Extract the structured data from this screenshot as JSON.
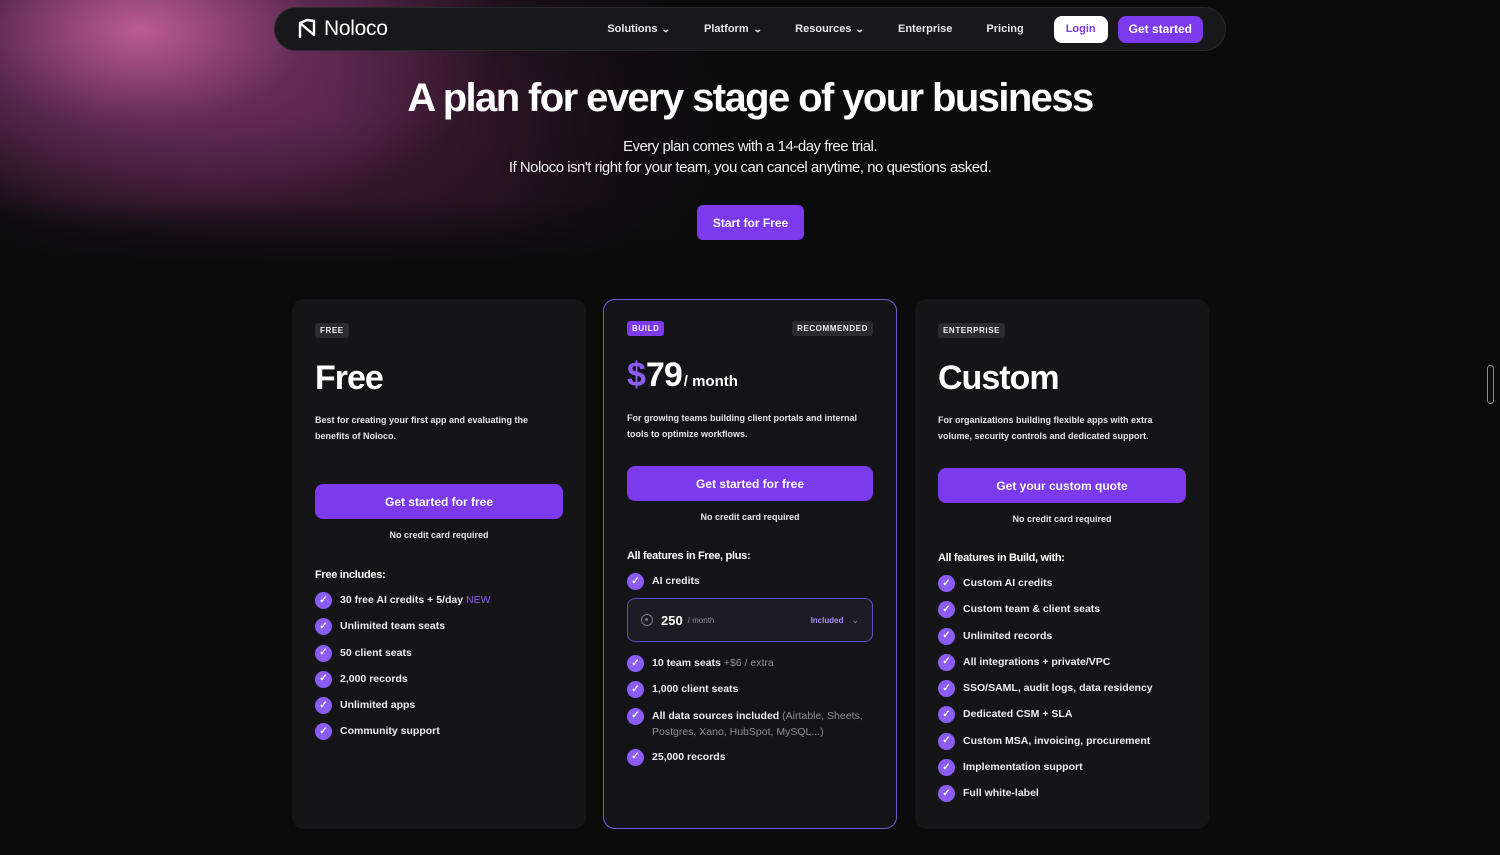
{
  "nav": {
    "logo": "Noloco",
    "links": [
      {
        "label": "Solutions",
        "dropdown": true
      },
      {
        "label": "Platform",
        "dropdown": true
      },
      {
        "label": "Resources",
        "dropdown": true
      },
      {
        "label": "Enterprise",
        "dropdown": false
      },
      {
        "label": "Pricing",
        "dropdown": false
      }
    ],
    "login": "Login",
    "get_started": "Get started"
  },
  "hero": {
    "title": "A plan for every stage of your business",
    "sub1": "Every plan comes with a 14-day free trial.",
    "sub2": "If Noloco isn't right for your team, you can cancel anytime, no questions asked.",
    "cta": "Start for Free"
  },
  "colors": {
    "accent": "#7c3aed",
    "accent_light": "#8b5cf6",
    "background": "#0b0b0c",
    "card": "#151517"
  },
  "plans": {
    "free": {
      "badge": "FREE",
      "name": "Free",
      "desc": "Best for creating your first app and evaluating the benefits of Noloco.",
      "cta": "Get started for free",
      "no_cc": "No credit card required",
      "feat_head": "Free includes:",
      "features": [
        {
          "text": "30 free AI credits + 5/day",
          "extra": "NEW"
        },
        {
          "text": "Unlimited team seats"
        },
        {
          "text": "50 client seats"
        },
        {
          "text": "2,000 records"
        },
        {
          "text": "Unlimited apps"
        },
        {
          "text": "Community support"
        }
      ]
    },
    "build": {
      "badge": "BUILD",
      "badge2": "RECOMMENDED",
      "currency": "$",
      "amount": "79",
      "per": "/ month",
      "desc": "For growing teams building client portals and internal tools to optimize workflows.",
      "cta": "Get started for free",
      "no_cc": "No credit card required",
      "feat_head": "All features in Free, plus:",
      "ai_credits": "AI credits",
      "credits": {
        "value": "250",
        "per": "/ month",
        "status": "Included"
      },
      "features": [
        {
          "text": "10 team seats",
          "extra": "+$6 / extra"
        },
        {
          "text": "1,000 client seats"
        },
        {
          "text": "All data sources included",
          "extra": "(Airtable, Sheets, Postgres, Xano, HubSpot, MySQL...)"
        },
        {
          "text": "25,000 records"
        }
      ]
    },
    "enterprise": {
      "badge": "ENTERPRISE",
      "name": "Custom",
      "desc": "For organizations building flexible apps with extra volume, security controls and dedicated support.",
      "cta": "Get your custom quote",
      "no_cc": "No credit card required",
      "feat_head": "All features in Build, with:",
      "features": [
        {
          "text": "Custom AI credits"
        },
        {
          "text": "Custom team & client seats"
        },
        {
          "text": "Unlimited records"
        },
        {
          "text": "All integrations + private/VPC"
        },
        {
          "text": "SSO/SAML, audit logs, data residency"
        },
        {
          "text": "Dedicated CSM + SLA"
        },
        {
          "text": "Custom MSA, invoicing, procurement"
        },
        {
          "text": "Implementation support"
        },
        {
          "text": "Full white-label"
        }
      ]
    }
  }
}
